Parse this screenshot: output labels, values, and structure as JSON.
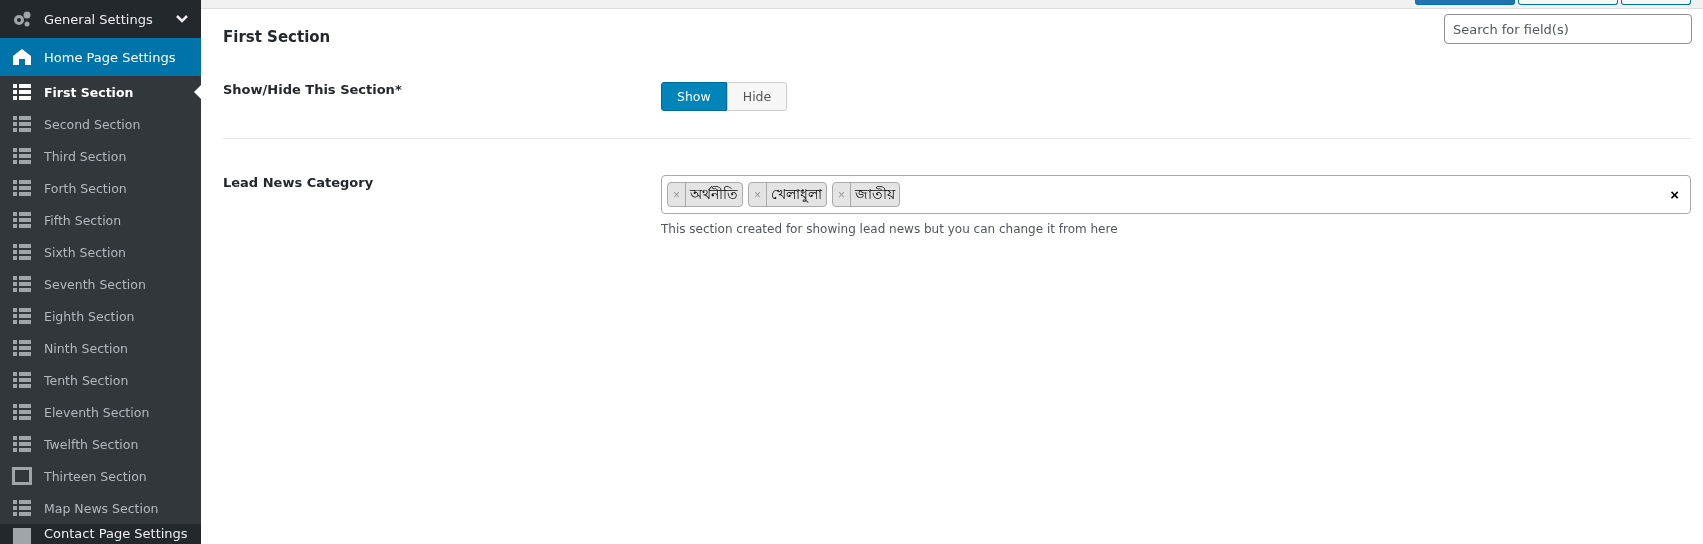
{
  "sidebar": {
    "menu": [
      {
        "kind": "gears",
        "label": "General Settings",
        "expanded": false,
        "selected": false
      },
      {
        "kind": "house",
        "label": "Home Page Settings",
        "expanded": true,
        "selected": true,
        "children": [
          {
            "kind": "list",
            "label": "First Section",
            "selected": true
          },
          {
            "kind": "list",
            "label": "Second Section",
            "selected": false
          },
          {
            "kind": "list",
            "label": "Third Section",
            "selected": false
          },
          {
            "kind": "list",
            "label": "Forth Section",
            "selected": false
          },
          {
            "kind": "list",
            "label": "Fifth Section",
            "selected": false
          },
          {
            "kind": "list",
            "label": "Sixth Section",
            "selected": false
          },
          {
            "kind": "list",
            "label": "Seventh Section",
            "selected": false
          },
          {
            "kind": "list",
            "label": "Eighth Section",
            "selected": false
          },
          {
            "kind": "list",
            "label": "Ninth Section",
            "selected": false
          },
          {
            "kind": "list",
            "label": "Tenth Section",
            "selected": false
          },
          {
            "kind": "list",
            "label": "Eleventh Section",
            "selected": false
          },
          {
            "kind": "list",
            "label": "Twelfth Section",
            "selected": false
          },
          {
            "kind": "monitor",
            "label": "Thirteen Section",
            "selected": false
          },
          {
            "kind": "list",
            "label": "Map News Section",
            "selected": false
          }
        ]
      },
      {
        "kind": "card",
        "label": "Contact Page Settings",
        "expanded": false,
        "selected": false
      }
    ]
  },
  "search": {
    "placeholder": "Search for field(s)"
  },
  "section": {
    "title": "First Section",
    "fields": [
      {
        "kind": "toggle",
        "label": "Show/Hide This Section*",
        "options": [
          {
            "label": "Show",
            "selected": true
          },
          {
            "label": "Hide",
            "selected": false
          }
        ]
      },
      {
        "kind": "tags",
        "label": "Lead News Category",
        "tags": [
          {
            "remove": "×",
            "label": "অর্থনীতি"
          },
          {
            "remove": "×",
            "label": "খেলাধুলা"
          },
          {
            "remove": "×",
            "label": "জাতীয়"
          }
        ],
        "clear": "×",
        "help": "This section created for showing lead news but you can change it from here"
      }
    ]
  }
}
